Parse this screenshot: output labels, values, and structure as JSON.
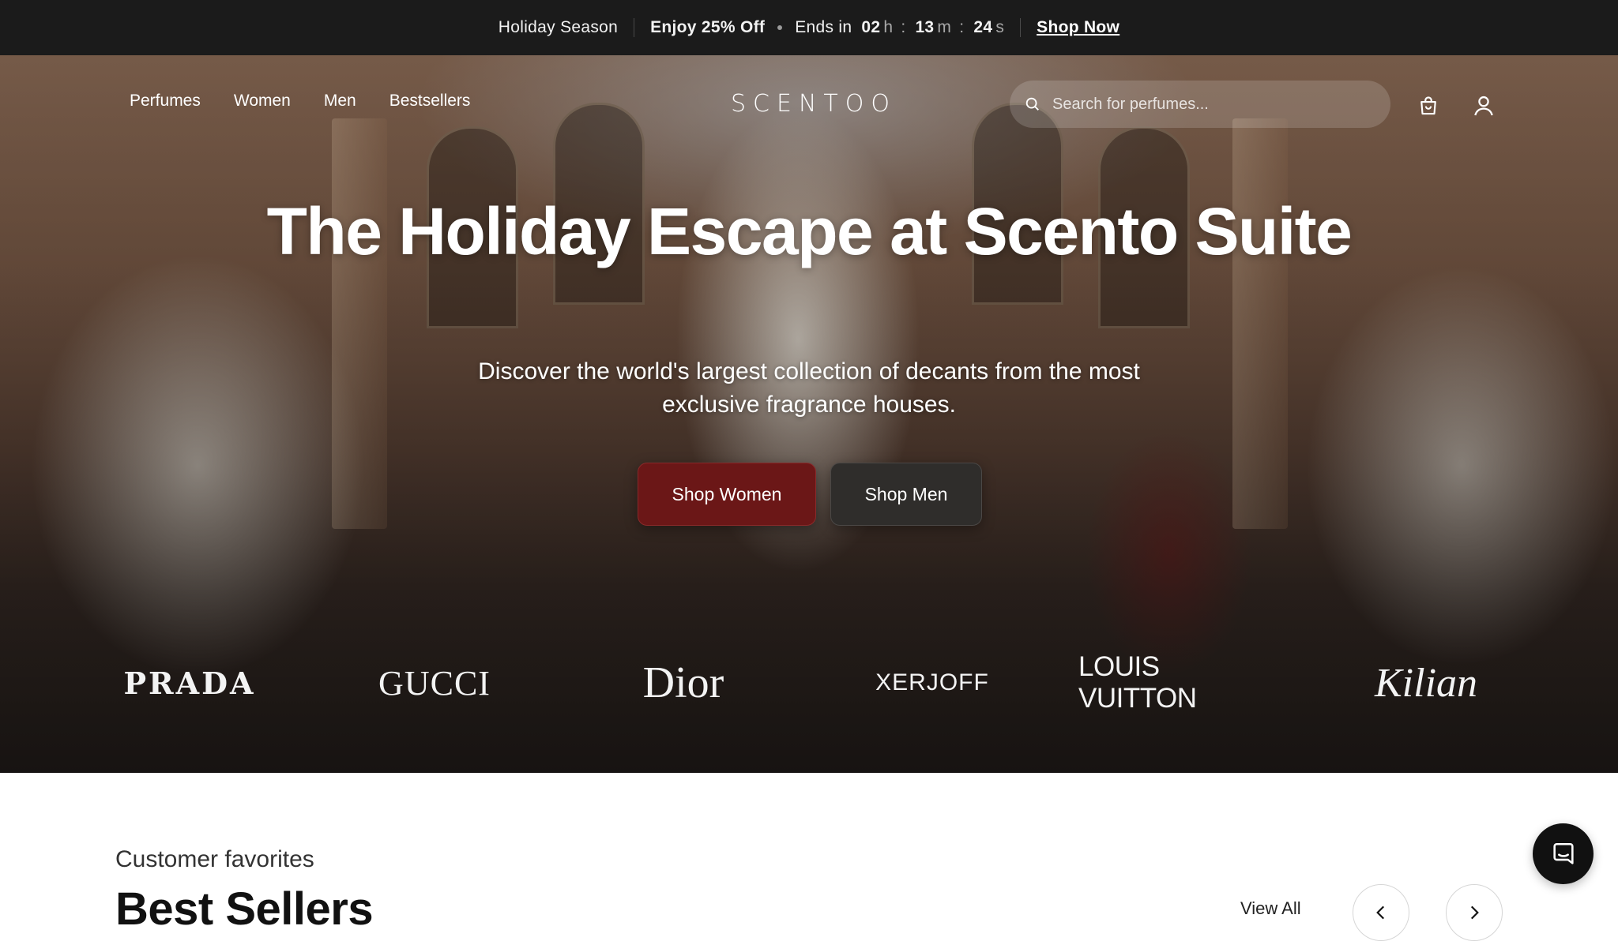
{
  "promo": {
    "label": "Holiday Season",
    "offer": "Enjoy 25% Off",
    "ends_label": "Ends in",
    "hours": "02",
    "hours_unit": "h",
    "minutes": "13",
    "minutes_unit": "m",
    "seconds": "24",
    "seconds_unit": "s",
    "cta": "Shop Now"
  },
  "nav": {
    "links": [
      "Perfumes",
      "Women",
      "Men",
      "Bestsellers"
    ],
    "logo": "SCENTOO"
  },
  "search": {
    "placeholder": "Search for perfumes..."
  },
  "icons": {
    "search": "search-icon",
    "bag": "shopping-bag-icon",
    "account": "user-icon",
    "chat": "chat-icon"
  },
  "hero": {
    "title": "The Holiday Escape at Scento Suite",
    "subtitle": "Discover the world's largest collection of decants from the most exclusive fragrance houses.",
    "buttons": {
      "women": "Shop Women",
      "men": "Shop Men"
    },
    "button_colors": {
      "women": "#6b1717",
      "men": "#2f2d2b"
    }
  },
  "brands": [
    "PRADA",
    "GUCCI",
    "Dior",
    "XERJOFF",
    "LOUIS VUITTON",
    "Kilian"
  ],
  "section": {
    "kicker": "Customer favorites",
    "title": "Best Sellers",
    "view_all": "View All"
  }
}
